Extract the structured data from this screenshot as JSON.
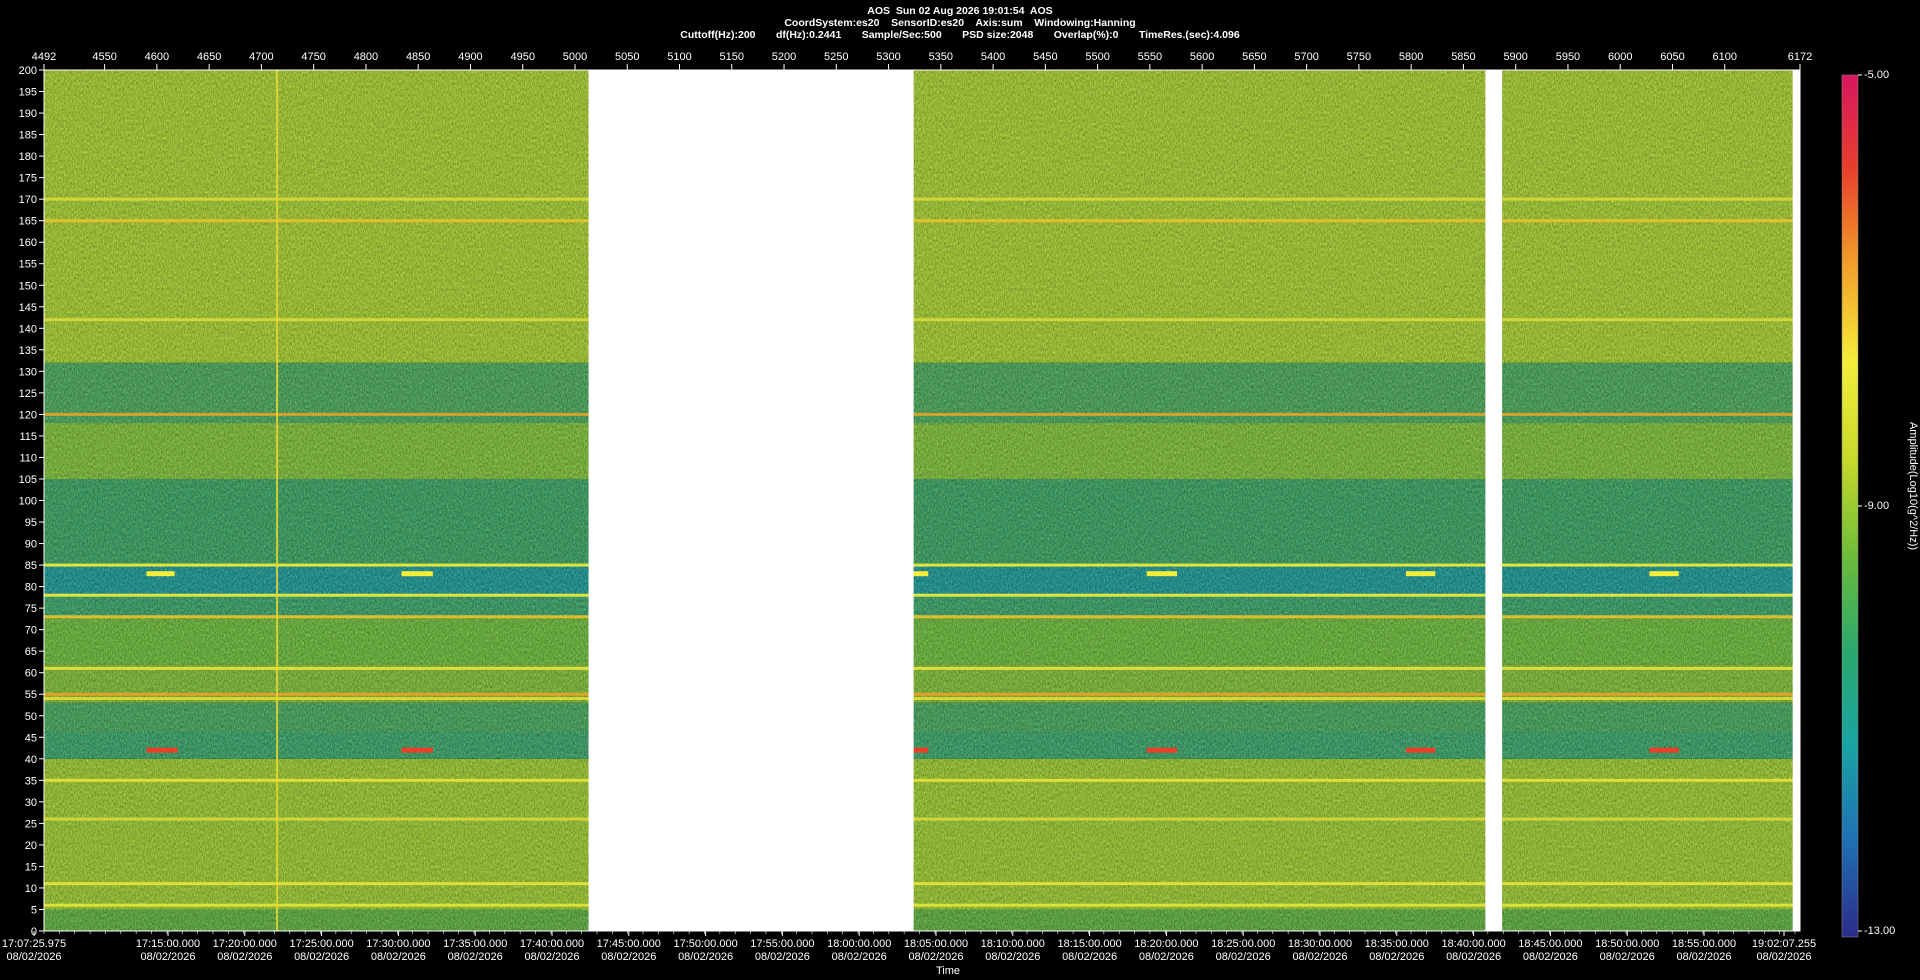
{
  "header": {
    "line1": "AOS  Sun 02 Aug 2026 19:01:54  AOS",
    "line2": "CoordSystem:es20    SensorID:es20    Axis:sum    Windowing:Hanning",
    "line3": "Cuttoff(Hz):200       df(Hz):0.2441       Sample/Sec:500       PSD size:2048       Overlap(%):0       TimeRes.(sec):4.096"
  },
  "colorbar": {
    "title": "Amplitude(Log10(g^2/Hz))",
    "ticks": [
      "-5.00",
      "-9.00",
      "-13.00"
    ],
    "colors": [
      "#2b2b8a",
      "#1f6fb5",
      "#1aa3a3",
      "#2aa86b",
      "#6fbd3a",
      "#c8d92b",
      "#f4ee3a",
      "#f2a12a",
      "#e8402a",
      "#d81560"
    ]
  },
  "chart_data": {
    "type": "heatmap",
    "title": "",
    "xlabel": "Time",
    "ylabel": "",
    "ylim": [
      0,
      200
    ],
    "top_axis": {
      "range": [
        4492,
        6172
      ],
      "ticks": [
        "4492",
        "4550",
        "4600",
        "4650",
        "4700",
        "4750",
        "4800",
        "4850",
        "4900",
        "4950",
        "5000",
        "5050",
        "5100",
        "5150",
        "5200",
        "5250",
        "5300",
        "5350",
        "5400",
        "5450",
        "5500",
        "5550",
        "5600",
        "5650",
        "5700",
        "5750",
        "5800",
        "5850",
        "5900",
        "5950",
        "6000",
        "6050",
        "6100",
        "6172"
      ]
    },
    "y_ticks": [
      "0",
      "5",
      "10",
      "15",
      "20",
      "25",
      "30",
      "35",
      "40",
      "45",
      "50",
      "55",
      "60",
      "65",
      "70",
      "75",
      "80",
      "85",
      "90",
      "95",
      "100",
      "105",
      "110",
      "115",
      "120",
      "125",
      "130",
      "135",
      "140",
      "145",
      "150",
      "155",
      "160",
      "165",
      "170",
      "175",
      "180",
      "185",
      "190",
      "195",
      "200"
    ],
    "x_ticks": [
      {
        "time": "17:07:25.975",
        "date": "08/02/2026"
      },
      {
        "time": "17:15:00.000",
        "date": "08/02/2026"
      },
      {
        "time": "17:20:00.000",
        "date": "08/02/2026"
      },
      {
        "time": "17:25:00.000",
        "date": "08/02/2026"
      },
      {
        "time": "17:30:00.000",
        "date": "08/02/2026"
      },
      {
        "time": "17:35:00.000",
        "date": "08/02/2026"
      },
      {
        "time": "17:40:00.000",
        "date": "08/02/2026"
      },
      {
        "time": "17:45:00.000",
        "date": "08/02/2026"
      },
      {
        "time": "17:50:00.000",
        "date": "08/02/2026"
      },
      {
        "time": "17:55:00.000",
        "date": "08/02/2026"
      },
      {
        "time": "18:00:00.000",
        "date": "08/02/2026"
      },
      {
        "time": "18:05:00.000",
        "date": "08/02/2026"
      },
      {
        "time": "18:10:00.000",
        "date": "08/02/2026"
      },
      {
        "time": "18:15:00.000",
        "date": "08/02/2026"
      },
      {
        "time": "18:20:00.000",
        "date": "08/02/2026"
      },
      {
        "time": "18:25:00.000",
        "date": "08/02/2026"
      },
      {
        "time": "18:30:00.000",
        "date": "08/02/2026"
      },
      {
        "time": "18:35:00.000",
        "date": "08/02/2026"
      },
      {
        "time": "18:40:00.000",
        "date": "08/02/2026"
      },
      {
        "time": "18:45:00.000",
        "date": "08/02/2026"
      },
      {
        "time": "18:50:00.000",
        "date": "08/02/2026"
      },
      {
        "time": "18:55:00.000",
        "date": "08/02/2026"
      },
      {
        "time": "19:02:07.255",
        "date": "08/02/2026"
      }
    ],
    "gaps_x": [
      [
        5013,
        5324
      ],
      [
        5871,
        5887
      ],
      [
        6165,
        6172
      ]
    ],
    "background_bands": [
      {
        "y": [
          0,
          5
        ],
        "color": "#5fb04a"
      },
      {
        "y": [
          5,
          40
        ],
        "color": "#9ccb3a"
      },
      {
        "y": [
          40,
          46
        ],
        "color": "#3aa573"
      },
      {
        "y": [
          46,
          53
        ],
        "color": "#46a866"
      },
      {
        "y": [
          53,
          62
        ],
        "color": "#7fbf42"
      },
      {
        "y": [
          62,
          73
        ],
        "color": "#6dbb44"
      },
      {
        "y": [
          73,
          78
        ],
        "color": "#3aa573"
      },
      {
        "y": [
          78,
          85
        ],
        "color": "#1c9aa0"
      },
      {
        "y": [
          85,
          105
        ],
        "color": "#3ba46c"
      },
      {
        "y": [
          105,
          118
        ],
        "color": "#7fc043"
      },
      {
        "y": [
          118,
          132
        ],
        "color": "#4aa964"
      },
      {
        "y": [
          132,
          200
        ],
        "color": "#a7cf3b"
      }
    ],
    "harmonic_lines": [
      {
        "freq": 165,
        "color": "#e8c230"
      },
      {
        "freq": 170,
        "color": "#d9d93a"
      },
      {
        "freq": 142,
        "color": "#d9d93a"
      },
      {
        "freq": 120,
        "color": "#e0a52a"
      },
      {
        "freq": 85,
        "color": "#f4ee3a"
      },
      {
        "freq": 78,
        "color": "#f4ee3a"
      },
      {
        "freq": 73,
        "color": "#f0c22a"
      },
      {
        "freq": 61,
        "color": "#e6e63a"
      },
      {
        "freq": 55,
        "color": "#f0a12a"
      },
      {
        "freq": 54,
        "color": "#e8d830"
      },
      {
        "freq": 35,
        "color": "#e8e23a"
      },
      {
        "freq": 26,
        "color": "#d9d93a"
      },
      {
        "freq": 11,
        "color": "#e6e63a"
      },
      {
        "freq": 6,
        "color": "#e6e63a"
      }
    ],
    "markers": [
      {
        "x": [
          4590,
          4617
        ],
        "freq": 83,
        "color": "#f4ee3a"
      },
      {
        "x": [
          4834,
          4864
        ],
        "freq": 83,
        "color": "#f4ee3a"
      },
      {
        "x": [
          5324,
          5338
        ],
        "freq": 83,
        "color": "#f4ee3a"
      },
      {
        "x": [
          5547,
          5576
        ],
        "freq": 83,
        "color": "#f4ee3a"
      },
      {
        "x": [
          5795,
          5823
        ],
        "freq": 83,
        "color": "#f4ee3a"
      },
      {
        "x": [
          6028,
          6056
        ],
        "freq": 83,
        "color": "#f4ee3a"
      },
      {
        "x": [
          4590,
          4620
        ],
        "freq": 42,
        "color": "#e8402a"
      },
      {
        "x": [
          4834,
          4864
        ],
        "freq": 42,
        "color": "#e8402a"
      },
      {
        "x": [
          5324,
          5338
        ],
        "freq": 42,
        "color": "#e8402a"
      },
      {
        "x": [
          5547,
          5576
        ],
        "freq": 42,
        "color": "#e8402a"
      },
      {
        "x": [
          5795,
          5823
        ],
        "freq": 42,
        "color": "#e8402a"
      },
      {
        "x": [
          6028,
          6056
        ],
        "freq": 42,
        "color": "#e8402a"
      }
    ],
    "spike_x": 4715
  }
}
